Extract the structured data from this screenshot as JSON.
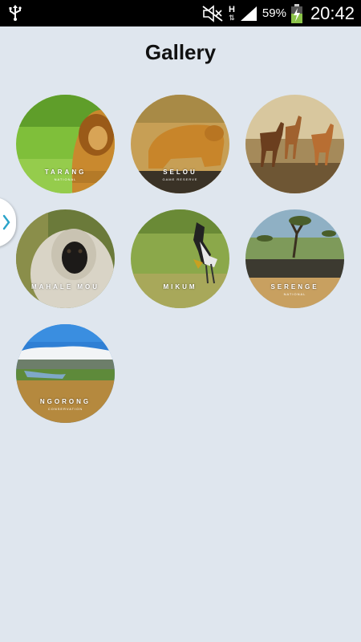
{
  "status_bar": {
    "network": "H",
    "battery_percent": "59%",
    "time": "20:42"
  },
  "page": {
    "title": "Gallery"
  },
  "gallery": {
    "items": [
      {
        "caption": "TARANG",
        "subtitle": "NATIONAL",
        "subject": "lion"
      },
      {
        "caption": "SELOU",
        "subtitle": "GAME RESERVE",
        "subject": "lioness"
      },
      {
        "caption": "",
        "subtitle": "",
        "subject": "impala"
      },
      {
        "caption": "MAHALE MOU",
        "subtitle": "",
        "subject": "monkey"
      },
      {
        "caption": "MIKUM",
        "subtitle": "",
        "subject": "crowned-crane"
      },
      {
        "caption": "SERENGE",
        "subtitle": "NATIONAL",
        "subject": "wildebeest"
      },
      {
        "caption": "NGORONG",
        "subtitle": "CONSERVATION",
        "subject": "crater"
      }
    ]
  },
  "colors": {
    "background": "#dfe6ee",
    "accent": "#2aa3c9"
  }
}
